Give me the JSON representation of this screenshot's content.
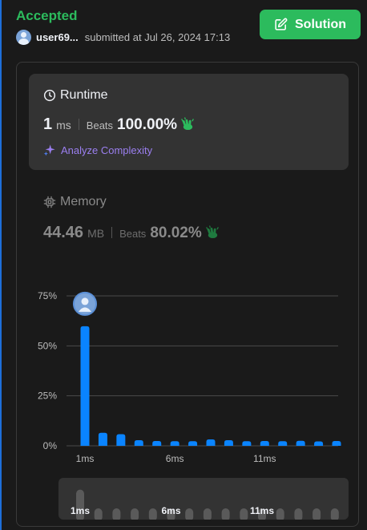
{
  "header": {
    "status": "Accepted",
    "username": "user69...",
    "submitted_text": "submitted at Jul 26, 2024 17:13",
    "solution_button": "Solution"
  },
  "runtime": {
    "title": "Runtime",
    "value": "1",
    "unit": "ms",
    "beats_label": "Beats",
    "beats_pct": "100.00%",
    "analyze_label": "Analyze Complexity"
  },
  "memory": {
    "title": "Memory",
    "value": "44.46",
    "unit": "MB",
    "beats_label": "Beats",
    "beats_pct": "80.02%"
  },
  "colors": {
    "accent_green": "#2cbb5d",
    "bar_blue": "#0a84ff",
    "analyze_purple": "#9b7ff0"
  },
  "chart_data": {
    "type": "bar",
    "ylim": [
      0,
      75
    ],
    "y_ticks": [
      "75%",
      "50%",
      "25%",
      "0%"
    ],
    "x_tick_labels": [
      {
        "index": 0,
        "label": "1ms"
      },
      {
        "index": 5,
        "label": "6ms"
      },
      {
        "index": 10,
        "label": "11ms"
      }
    ],
    "values": [
      59.8,
      6.5,
      5.8,
      2.8,
      2.4,
      2.3,
      2.3,
      3.2,
      2.8,
      2.3,
      2.4,
      2.3,
      2.5,
      2.2,
      2.4
    ],
    "highlight_index": 0,
    "grid": true
  },
  "mini_chart": {
    "x_tick_labels": [
      {
        "index": 0,
        "label": "1ms"
      },
      {
        "index": 5,
        "label": "6ms"
      },
      {
        "index": 10,
        "label": "11ms"
      }
    ]
  }
}
